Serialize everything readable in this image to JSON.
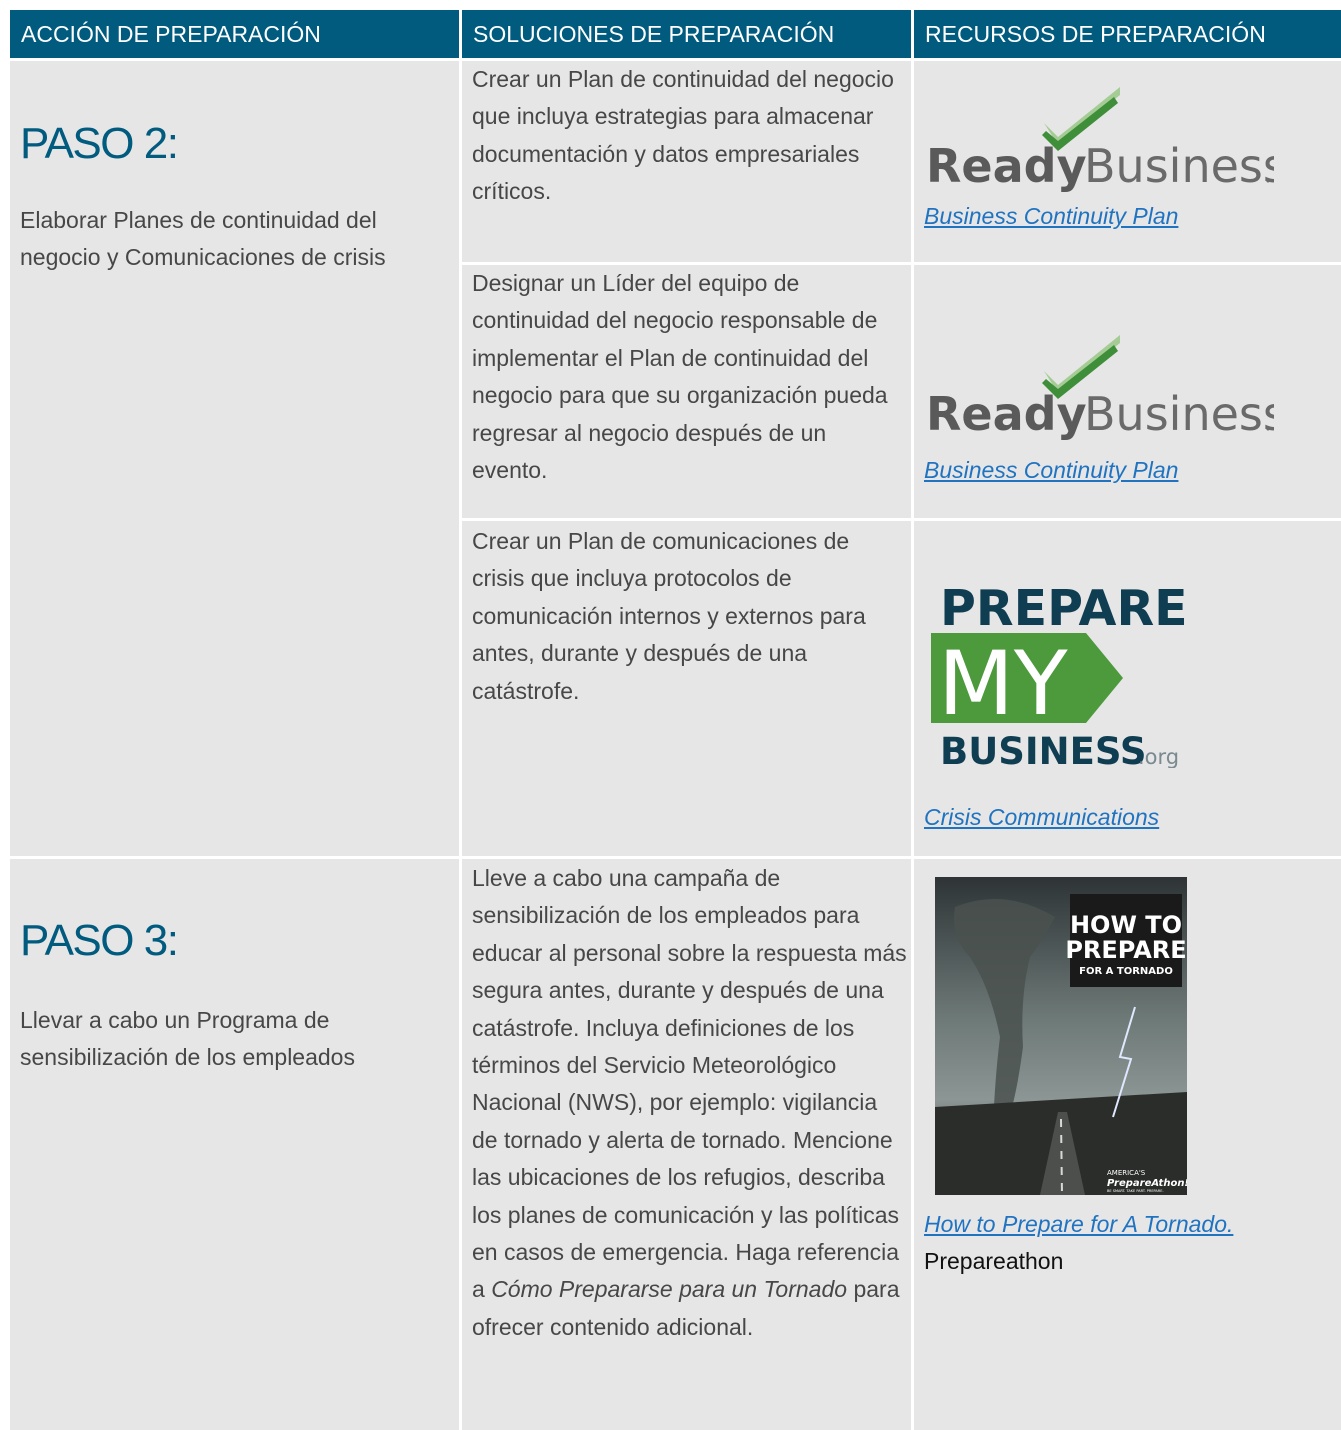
{
  "headers": {
    "col1": "ACCIÓN DE PREPARACIÓN",
    "col2": "SOLUCIONES DE PREPARACIÓN",
    "col3": "RECURSOS DE PREPARACIÓN"
  },
  "step2": {
    "title": "PASO 2:",
    "description": "Elaborar Planes de continuidad del negocio y Comunicaciones de crisis",
    "rows": [
      {
        "solution": "Crear un Plan de continuidad del negocio que incluya estrategias para almacenar documentación y datos empresariales críticos.",
        "logo_word1": "Ready",
        "logo_word2": "Business",
        "link": "Business Continuity Plan"
      },
      {
        "solution": "Designar un Líder del equipo de continuidad del negocio responsable de implementar el Plan de continuidad del negocio para que su organización pueda regresar al negocio después de un evento.",
        "logo_word1": "Ready",
        "logo_word2": "Business",
        "link": "Business Continuity Plan"
      },
      {
        "solution": "Crear un Plan de comunicaciones de crisis que incluya protocolos de comunicación internos y externos para antes, durante y después de una catástrofe.",
        "logo_line1": "PREPARE",
        "logo_line2": "MY",
        "logo_line3": "BUSINESS",
        "logo_suffix": ".org",
        "link": "Crisis Communications"
      }
    ]
  },
  "step3": {
    "title": "PASO 3:",
    "description": "Llevar a cabo un Programa de sensibilización de los empleados",
    "solution_before": "Lleve a cabo una campaña de sensibilización de los empleados para educar al personal sobre la respuesta más segura antes, durante y después de una catástrofe. Incluya definiciones de los términos del Servicio Meteorológico Nacional (NWS), por ejemplo: vigilancia de tornado y alerta de tornado.  Mencione las ubicaciones de los refugios, describa los planes de comunicación y las políticas en casos de emergencia. Haga referencia a ",
    "solution_italic": "Cómo Prepararse para un Tornado",
    "solution_after": " para ofrecer contenido adicional.",
    "cover_line1": "HOW TO",
    "cover_line2": "PREPARE",
    "cover_line3": "FOR A TORNADO",
    "cover_brand1": "AMERICA'S",
    "cover_brand2": "PrepareAthon!",
    "cover_tagline": "BE SMART. TAKE PART. PREPARE.",
    "link": "How to Prepare for A Tornado.",
    "source": "Prepareathon"
  },
  "colors": {
    "header_bg": "#005b7f",
    "cell_bg": "#e6e6e6",
    "title_blue": "#005b7f",
    "link_blue": "#1f73c1",
    "logo_green": "#4c9a3c",
    "logo_navy": "#0f3e52"
  }
}
